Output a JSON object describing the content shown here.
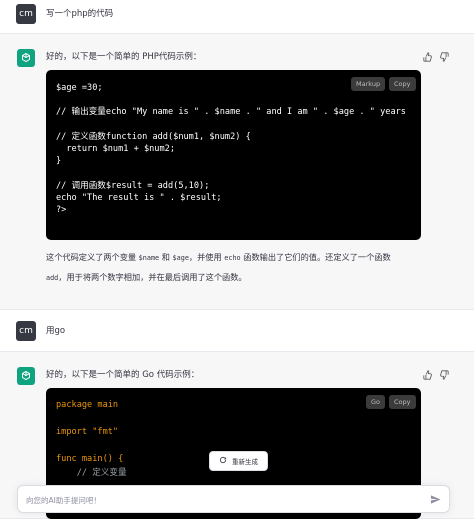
{
  "colors": {
    "accent": "#10a37f",
    "user_avatar": "#363842",
    "code_bg": "#000000",
    "keyword": "#e9950c"
  },
  "turns": [
    {
      "user": {
        "avatar": "cm",
        "text": "写一个php的代码"
      },
      "assistant": {
        "intro": "好的，以下是一个简单的 PHP代码示例：",
        "code_lang_label": "Markup",
        "copy_label": "Copy",
        "code_lines": [
          "$age =30;",
          "",
          "// 输出变量echo \"My name is \" . $name . \" and I am \" . $age . \" years",
          "",
          "// 定义函数function add($num1, $num2) {",
          "  return $num1 + $num2;",
          "}",
          "",
          "// 调用函数$result = add(5,10);",
          "echo \"The result is \" . $result;",
          "?>"
        ],
        "explain": {
          "p1": "这个代码定义了两个变量 ",
          "c1": "$name",
          "p2": " 和 ",
          "c2": "$age",
          "p3": "，并使用 ",
          "c3": "echo",
          "p4": " 函数输出了它们的值。还定义了一个函数",
          "c4": "add",
          "p5": "，用于将两个数字相加，并在最后调用了这个函数。"
        }
      }
    },
    {
      "user": {
        "avatar": "cm",
        "text": "用go"
      },
      "assistant": {
        "intro": "好的，以下是一个简单的 Go 代码示例：",
        "code_lang_label": "Go",
        "copy_label": "Copy",
        "code_lines": [
          "package main",
          "",
          "import \"fmt\"",
          "",
          "func main() {",
          "    // 定义变量"
        ]
      }
    }
  ],
  "regenerate_label": "重新生成",
  "composer": {
    "placeholder": "向您的AI助手提问吧！",
    "value": ""
  },
  "icons": [
    "thumbs-up-icon",
    "thumbs-down-icon",
    "send-icon",
    "refresh-icon",
    "openai-logo-icon"
  ]
}
